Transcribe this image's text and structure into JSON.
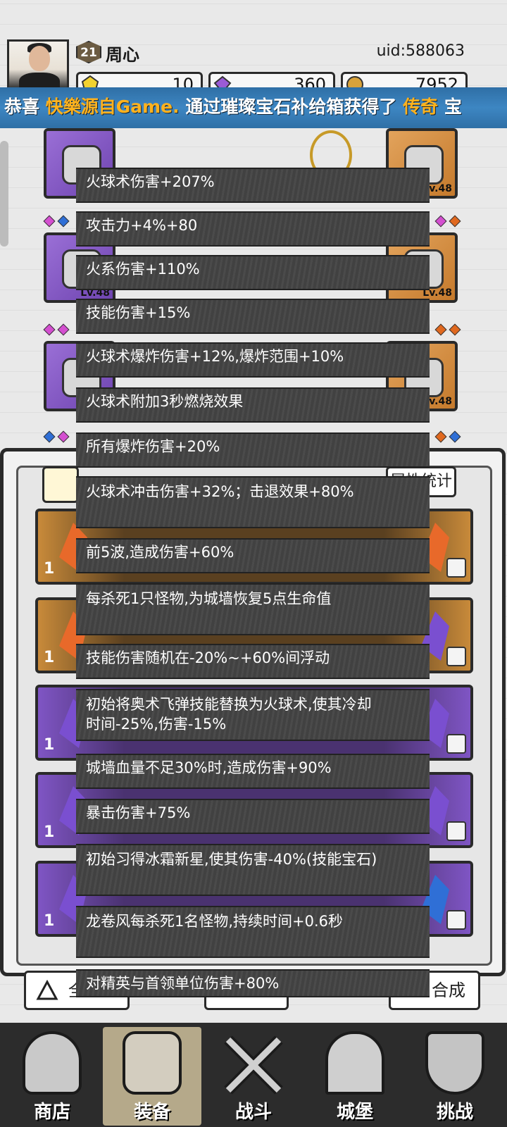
{
  "header": {
    "level": "21",
    "player_name": "周心",
    "uid": "uid:588063",
    "currencies": [
      {
        "name": "gold-crystal",
        "value": "10",
        "color": "#f2d230"
      },
      {
        "name": "purple-gem",
        "value": "360",
        "color": "#9a5bd6"
      },
      {
        "name": "coin",
        "value": "7952",
        "color": "#d8a23a"
      }
    ]
  },
  "banner": {
    "prefix": "恭喜",
    "player": "快樂源自Game.",
    "middle": "通过璀璨宝石补给箱获得了",
    "item": "传奇",
    "suffix": "宝"
  },
  "equipment": {
    "slots": [
      {
        "rarity": "purple",
        "level": ""
      },
      {
        "rarity": "purple",
        "level": "Lv.48"
      },
      {
        "rarity": "purple",
        "level": ""
      },
      {
        "rarity": "orange",
        "level": "Lv.48"
      },
      {
        "rarity": "orange",
        "level": "Lv.48"
      },
      {
        "rarity": "orange",
        "level": "Lv.48"
      }
    ]
  },
  "panel": {
    "attr_button": "属性统计",
    "item_count": "1",
    "bottom_left": "全",
    "bottom_right": "合成"
  },
  "tooltip_lines": [
    "火球术伤害+207%",
    "攻击力+4%+80",
    "火系伤害+110%",
    "技能伤害+15%",
    "火球术爆炸伤害+12%,爆炸范围+10%",
    "火球术附加3秒燃烧效果",
    "所有爆炸伤害+20%",
    "火球术冲击伤害+32%；击退效果+80%",
    "前5波,造成伤害+60%",
    "每杀死1只怪物,为城墙恢复5点生命值",
    "技能伤害随机在-20%~+60%间浮动",
    "初始将奥术飞弹技能替换为火球术,使其冷却时间-25%,伤害-15%",
    "城墙血量不足30%时,造成伤害+90%",
    "暴击伤害+75%",
    "初始习得冰霜新星,使其伤害-40%(技能宝石)",
    "龙卷风每杀死1名怪物,持续时间+0.6秒",
    "对精英与首领单位伤害+80%"
  ],
  "nav": [
    {
      "label": "商店",
      "icon": "shop-icon"
    },
    {
      "label": "装备",
      "icon": "backpack-icon",
      "active": true
    },
    {
      "label": "战斗",
      "icon": "crossed-swords-icon"
    },
    {
      "label": "城堡",
      "icon": "castle-icon"
    },
    {
      "label": "挑战",
      "icon": "shield-icon"
    }
  ]
}
